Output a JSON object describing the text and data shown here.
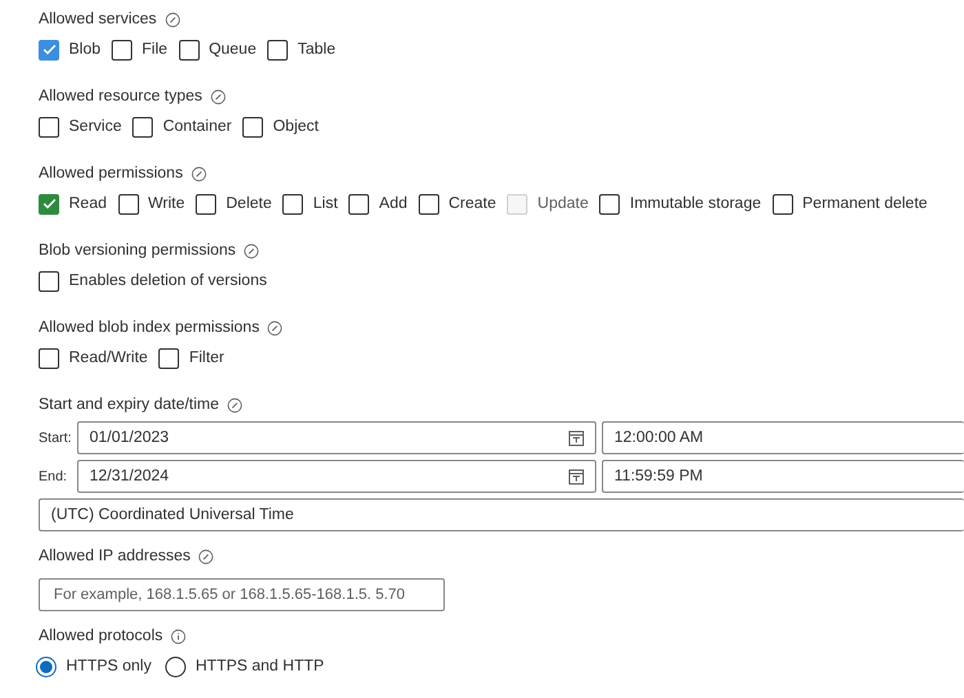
{
  "sections": [
    {
      "kind": "checkboxes",
      "label": "Allowed services",
      "options": [
        {
          "label": "Blob",
          "checked": true,
          "disabled": false,
          "color": "#3b8ee0"
        },
        {
          "label": "File",
          "checked": false,
          "disabled": false
        },
        {
          "label": "Queue",
          "checked": false,
          "disabled": false
        },
        {
          "label": "Table",
          "checked": false,
          "disabled": false
        }
      ]
    },
    {
      "kind": "checkboxes",
      "label": "Allowed resource types",
      "options": [
        {
          "label": "Service",
          "checked": false,
          "disabled": false
        },
        {
          "label": "Container",
          "checked": false,
          "disabled": false
        },
        {
          "label": "Object",
          "checked": false,
          "disabled": false
        }
      ]
    },
    {
      "kind": "checkboxes",
      "label": "Allowed permissions",
      "options": [
        {
          "label": "Read",
          "checked": true,
          "disabled": false,
          "color": "#2e8b3e"
        },
        {
          "label": "Write",
          "checked": false,
          "disabled": false
        },
        {
          "label": "Delete",
          "checked": false,
          "disabled": false
        },
        {
          "label": "List",
          "checked": false,
          "disabled": false
        },
        {
          "label": "Add",
          "checked": false,
          "disabled": false
        },
        {
          "label": "Create",
          "checked": false,
          "disabled": false
        },
        {
          "label": "Update",
          "checked": false,
          "disabled": true
        },
        {
          "label": "Immutable storage",
          "checked": false,
          "disabled": false
        },
        {
          "label": "Permanent delete",
          "checked": false,
          "disabled": false
        }
      ]
    },
    {
      "kind": "checkboxes",
      "label": "Blob versioning permissions",
      "options": [
        {
          "label": "Enables deletion of versions",
          "checked": false,
          "disabled": false
        }
      ]
    },
    {
      "kind": "checkboxes",
      "label": "Allowed blob index permissions",
      "options": [
        {
          "label": "Read/Write",
          "checked": false,
          "disabled": false
        },
        {
          "label": "Filter",
          "checked": false,
          "disabled": false
        }
      ]
    },
    {
      "kind": "datetime",
      "label": "Start and expiry date/time",
      "rows": [
        {
          "label": "Start:",
          "date": "01/01/2023",
          "time": "12:00:00 AM"
        },
        {
          "label": "End:",
          "date": "12/31/2024",
          "time": "11:59:59 PM"
        }
      ],
      "timezone": "(UTC) Coordinated Universal Time"
    },
    {
      "kind": "text_field",
      "label": "Allowed IP addresses",
      "placeholder": "For example, 168.1.5.65 or 168.1.5.65-168.1.5. 5.70"
    },
    {
      "kind": "radios",
      "label": "Allowed protocols",
      "options": [
        {
          "label": "HTTPS only",
          "selected": true
        },
        {
          "label": "HTTPS and HTTP",
          "selected": false
        }
      ]
    }
  ]
}
